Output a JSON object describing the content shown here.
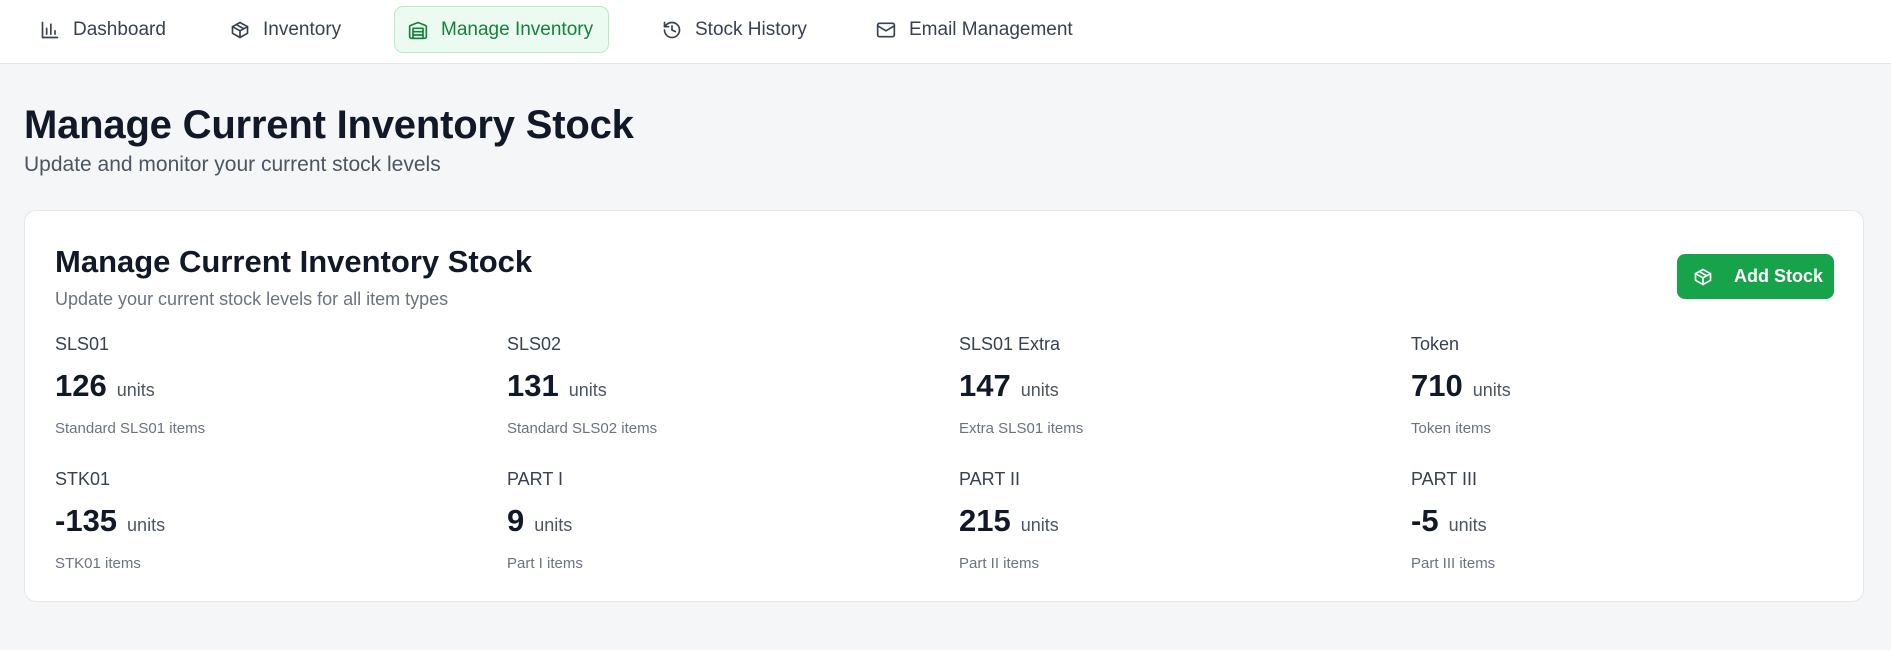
{
  "nav": {
    "items": [
      {
        "label": "Dashboard",
        "icon": "bar-chart-icon",
        "active": false
      },
      {
        "label": "Inventory",
        "icon": "package-icon",
        "active": false
      },
      {
        "label": "Manage Inventory",
        "icon": "warehouse-icon",
        "active": true
      },
      {
        "label": "Stock History",
        "icon": "history-icon",
        "active": false
      },
      {
        "label": "Email Management",
        "icon": "mail-icon",
        "active": false
      }
    ]
  },
  "page": {
    "title": "Manage Current Inventory Stock",
    "subtitle": "Update and monitor your current stock levels"
  },
  "card": {
    "title": "Manage Current Inventory Stock",
    "subtitle": "Update your current stock levels for all item types",
    "add_button_label": "Add Stock"
  },
  "stock_items": [
    {
      "name": "SLS01",
      "value": "126",
      "unit": "units",
      "description": "Standard SLS01 items"
    },
    {
      "name": "SLS02",
      "value": "131",
      "unit": "units",
      "description": "Standard SLS02 items"
    },
    {
      "name": "SLS01 Extra",
      "value": "147",
      "unit": "units",
      "description": "Extra SLS01 items"
    },
    {
      "name": "Token",
      "value": "710",
      "unit": "units",
      "description": "Token items"
    },
    {
      "name": "STK01",
      "value": "-135",
      "unit": "units",
      "description": "STK01 items"
    },
    {
      "name": "PART I",
      "value": "9",
      "unit": "units",
      "description": "Part I items"
    },
    {
      "name": "PART II",
      "value": "215",
      "unit": "units",
      "description": "Part II items"
    },
    {
      "name": "PART III",
      "value": "-5",
      "unit": "units",
      "description": "Part III items"
    }
  ],
  "colors": {
    "accent": "#16a34a",
    "active_nav_bg": "#ecfbf1",
    "active_nav_text": "#15803d",
    "page_bg": "#f5f6f8"
  }
}
